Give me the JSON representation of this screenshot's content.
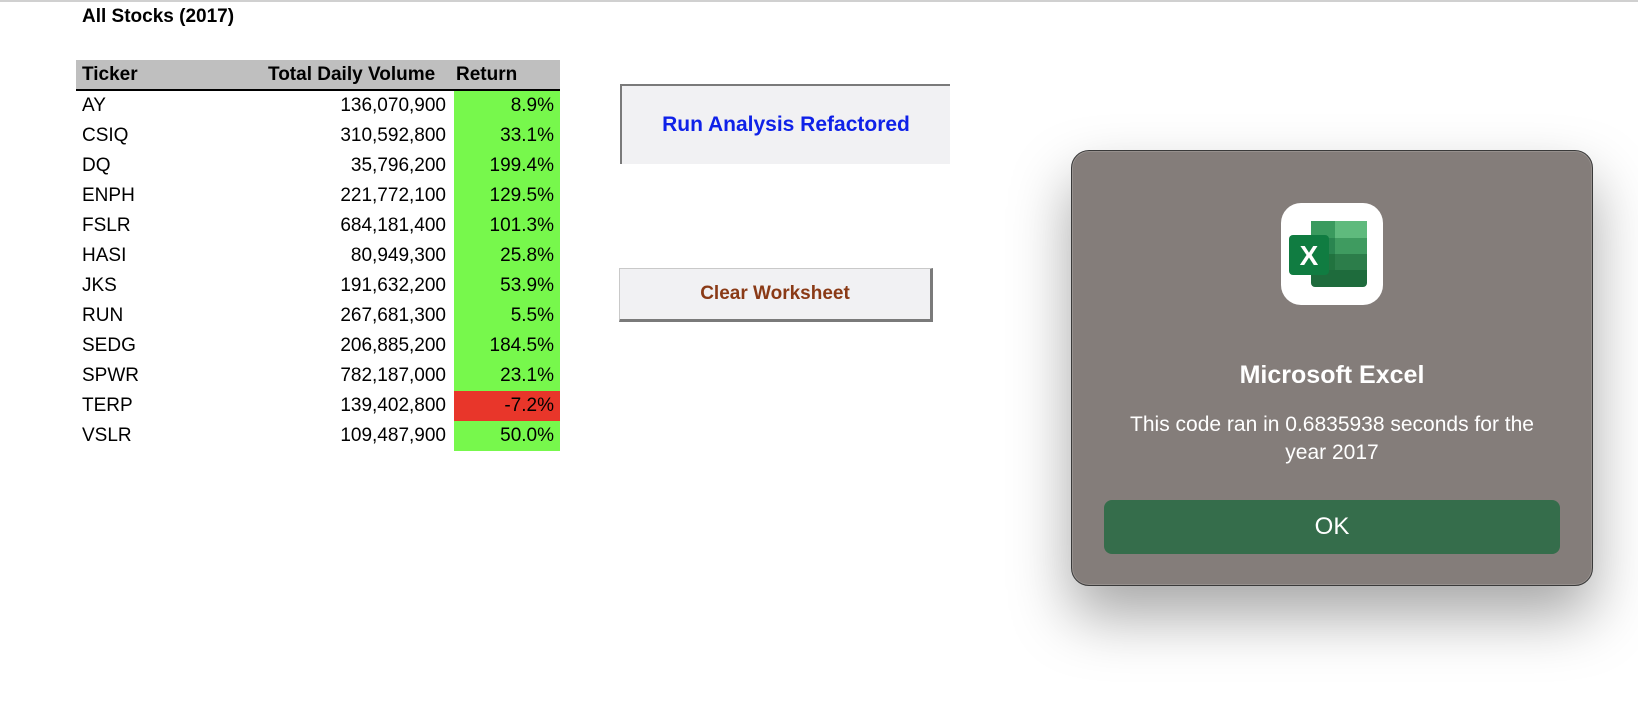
{
  "sheet": {
    "title": "All Stocks (2017)",
    "columns": [
      "Ticker",
      "Total Daily Volume",
      "Return"
    ],
    "rows": [
      {
        "ticker": "AY",
        "volume": "136,070,900",
        "ret": "8.9%",
        "status": "positive"
      },
      {
        "ticker": "CSIQ",
        "volume": "310,592,800",
        "ret": "33.1%",
        "status": "positive"
      },
      {
        "ticker": "DQ",
        "volume": "35,796,200",
        "ret": "199.4%",
        "status": "positive"
      },
      {
        "ticker": "ENPH",
        "volume": "221,772,100",
        "ret": "129.5%",
        "status": "positive"
      },
      {
        "ticker": "FSLR",
        "volume": "684,181,400",
        "ret": "101.3%",
        "status": "positive"
      },
      {
        "ticker": "HASI",
        "volume": "80,949,300",
        "ret": "25.8%",
        "status": "positive"
      },
      {
        "ticker": "JKS",
        "volume": "191,632,200",
        "ret": "53.9%",
        "status": "positive"
      },
      {
        "ticker": "RUN",
        "volume": "267,681,300",
        "ret": "5.5%",
        "status": "positive"
      },
      {
        "ticker": "SEDG",
        "volume": "206,885,200",
        "ret": "184.5%",
        "status": "positive"
      },
      {
        "ticker": "SPWR",
        "volume": "782,187,000",
        "ret": "23.1%",
        "status": "positive"
      },
      {
        "ticker": "TERP",
        "volume": "139,402,800",
        "ret": "-7.2%",
        "status": "negative"
      },
      {
        "ticker": "VSLR",
        "volume": "109,487,900",
        "ret": "50.0%",
        "status": "positive"
      }
    ],
    "colors": {
      "positive": "#77f84c",
      "negative": "#e8362a",
      "header_bg": "#bfbfbf"
    }
  },
  "buttons": {
    "run_label": "Run Analysis Refactored",
    "clear_label": "Clear Worksheet"
  },
  "dialog": {
    "app_name": "Microsoft Excel",
    "message": "This code ran in 0.6835938 seconds for the year 2017",
    "ok_label": "OK",
    "icon": "excel-app-icon",
    "icon_letter": "X"
  }
}
